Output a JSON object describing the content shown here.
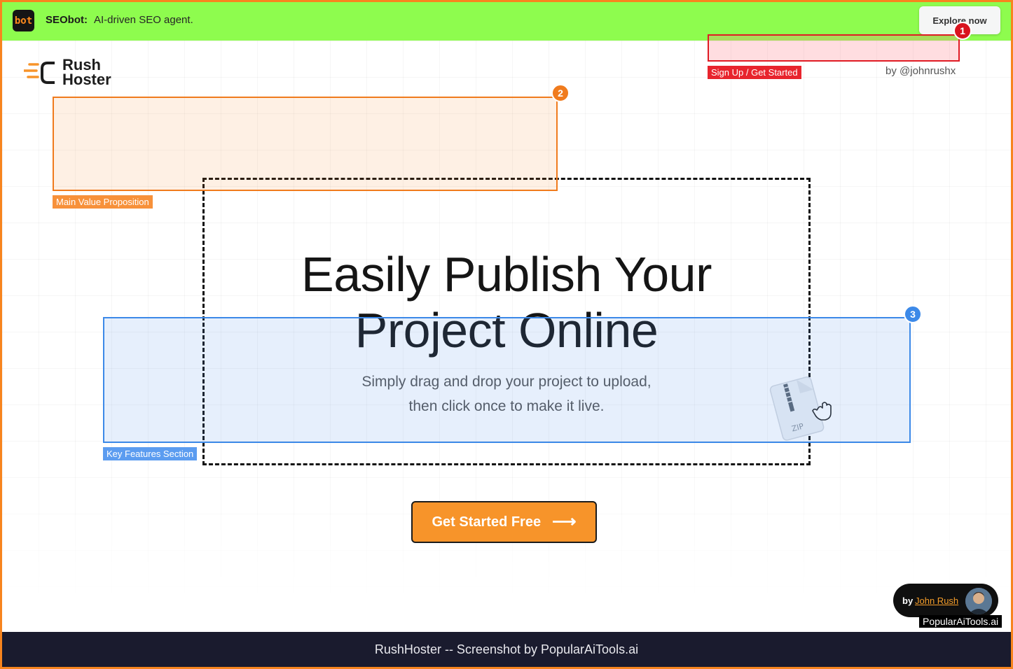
{
  "banner": {
    "logo_text": "bot",
    "brand": "SEObot:",
    "tagline": "AI-driven SEO agent.",
    "explore_label": "Explore now"
  },
  "header": {
    "logo_line1": "Rush",
    "logo_line2": "Hoster",
    "byline": "by @johnrushx"
  },
  "annotations": [
    {
      "number": "1",
      "label": "Sign Up / Get Started",
      "color": "#e01b24"
    },
    {
      "number": "2",
      "label": "Main Value Proposition",
      "color": "#f07b1d"
    },
    {
      "number": "3",
      "label": "Key Features Section",
      "color": "#3c89e8"
    }
  ],
  "hero": {
    "title_line1": "Easily Publish Your",
    "title_line2": "Project Online",
    "subtitle_line1": "Simply drag and drop your project to upload,",
    "subtitle_line2": "then click once to make it live.",
    "zip_label": "ZIP",
    "cta_label": "Get Started Free",
    "cta_icon": "arrow-right-icon"
  },
  "credit": {
    "by": "by",
    "name": "John Rush",
    "watermark": "PopularAiTools.ai"
  },
  "footer": {
    "text": "RushHoster -- Screenshot by PopularAiTools.ai"
  },
  "colors": {
    "banner_bg": "#8efc4e",
    "accent_orange": "#f7942a",
    "footer_bg": "#1a1b2e"
  }
}
